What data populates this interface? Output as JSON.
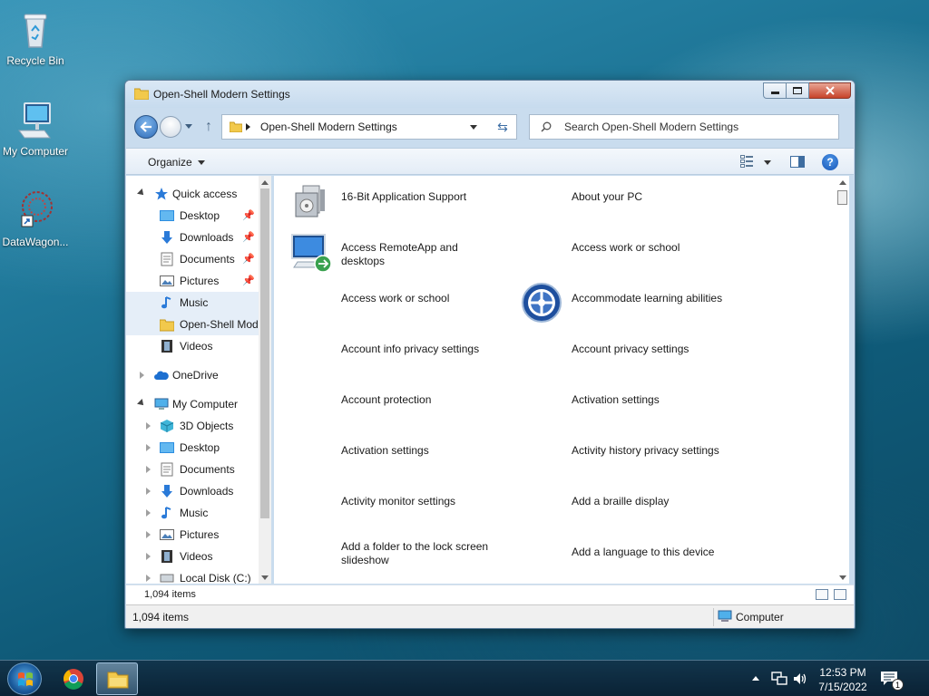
{
  "desktop": {
    "icons": [
      {
        "label": "Recycle Bin"
      },
      {
        "label": "My Computer"
      },
      {
        "label": "DataWagon..."
      }
    ]
  },
  "window": {
    "title": "Open-Shell Modern Settings",
    "address_path": "Open-Shell Modern Settings",
    "search_placeholder": "Search Open-Shell Modern Settings",
    "organize_label": "Organize",
    "help_label": "?"
  },
  "nav_pane": {
    "items": [
      {
        "label": "Quick access",
        "icon": "star-icon"
      },
      {
        "label": "Desktop",
        "icon": "desktop-folder-icon"
      },
      {
        "label": "Downloads",
        "icon": "download-arrow-icon"
      },
      {
        "label": "Documents",
        "icon": "document-icon"
      },
      {
        "label": "Pictures",
        "icon": "picture-icon"
      },
      {
        "label": "Music",
        "icon": "music-note-icon"
      },
      {
        "label": "Open-Shell Modern Settings",
        "icon": "folder-icon"
      },
      {
        "label": "Videos",
        "icon": "film-icon"
      },
      {
        "label": "OneDrive",
        "icon": "cloud-icon"
      },
      {
        "label": "My Computer",
        "icon": "computer-icon"
      },
      {
        "label": "3D Objects",
        "icon": "cube-icon"
      },
      {
        "label": "Desktop",
        "icon": "desktop-folder-icon"
      },
      {
        "label": "Documents",
        "icon": "document-icon"
      },
      {
        "label": "Downloads",
        "icon": "download-arrow-icon"
      },
      {
        "label": "Music",
        "icon": "music-note-icon"
      },
      {
        "label": "Pictures",
        "icon": "picture-icon"
      },
      {
        "label": "Videos",
        "icon": "film-icon"
      },
      {
        "label": "Local Disk (C:)",
        "icon": "disk-icon"
      }
    ]
  },
  "content": {
    "items": [
      {
        "label": "16-Bit Application Support",
        "icon": "application-support-icon"
      },
      {
        "label": "About your PC",
        "icon": ""
      },
      {
        "label": "Access RemoteApp and desktops",
        "icon": "remote-desktop-icon"
      },
      {
        "label": "Access work or school",
        "icon": ""
      },
      {
        "label": "Access work or school",
        "icon": ""
      },
      {
        "label": "Accommodate learning abilities",
        "icon": "ease-of-access-icon"
      },
      {
        "label": "Account info privacy settings",
        "icon": ""
      },
      {
        "label": "Account privacy settings",
        "icon": ""
      },
      {
        "label": "Account protection",
        "icon": ""
      },
      {
        "label": "Activation settings",
        "icon": ""
      },
      {
        "label": "Activation settings",
        "icon": ""
      },
      {
        "label": "Activity history privacy settings",
        "icon": ""
      },
      {
        "label": "Activity monitor settings",
        "icon": ""
      },
      {
        "label": "Add a braille display",
        "icon": ""
      },
      {
        "label": "Add a folder to the lock screen slideshow",
        "icon": ""
      },
      {
        "label": "Add a language to this device",
        "icon": ""
      }
    ]
  },
  "details_bar": {
    "item_count": "1,094 items"
  },
  "status_bar": {
    "left": "1,094 items",
    "right": "Computer"
  },
  "taskbar": {
    "time": "12:53 PM",
    "date": "7/15/2022",
    "notification_count": "1"
  }
}
